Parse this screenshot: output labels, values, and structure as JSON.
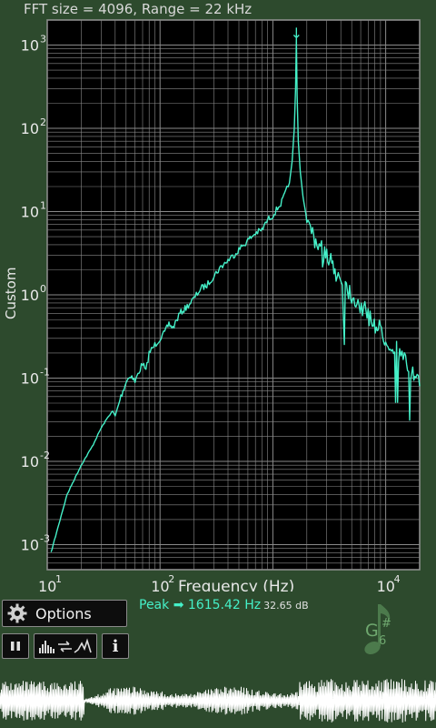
{
  "header": {
    "title": "FFT size = 4096, Range = 22 kHz"
  },
  "chart_data": {
    "type": "line",
    "title": "",
    "xlabel": "Frequency (Hz)",
    "ylabel": "Custom",
    "x_scale": "log",
    "y_scale": "log",
    "xlim": [
      10,
      20000
    ],
    "ylim": [
      0.0005,
      2000
    ],
    "x_ticks": [
      {
        "base": "10",
        "exp": "1",
        "value": 10
      },
      {
        "base": "10",
        "exp": "2",
        "value": 100
      },
      {
        "base": "10",
        "exp": "4",
        "value": 10000
      }
    ],
    "y_ticks": [
      {
        "base": "10",
        "exp": "3",
        "value": 1000
      },
      {
        "base": "10",
        "exp": "2",
        "value": 100
      },
      {
        "base": "10",
        "exp": "1",
        "value": 10
      },
      {
        "base": "10",
        "exp": "0",
        "value": 1
      },
      {
        "base": "10",
        "exp": "-1",
        "value": 0.1
      },
      {
        "base": "10",
        "exp": "-2",
        "value": 0.01
      },
      {
        "base": "10",
        "exp": "-3",
        "value": 0.001
      }
    ],
    "grid": true,
    "line_color": "#45f0c8",
    "peak_marker": {
      "x": 1615.42,
      "symbol": "↓"
    },
    "series": [
      {
        "x": [
          10.8,
          13,
          15,
          20,
          25,
          30,
          35,
          38,
          40,
          45,
          50,
          55,
          60,
          65,
          70,
          75,
          80,
          90,
          100,
          110,
          120,
          130,
          150,
          170,
          200,
          230,
          260,
          300,
          350,
          400,
          450,
          500,
          600,
          700,
          800,
          900,
          1000,
          1100,
          1200,
          1300,
          1400,
          1480,
          1550,
          1590,
          1615,
          1640,
          1680,
          1750,
          1850,
          2000,
          2200,
          2400,
          2700,
          3000,
          3400,
          3800,
          4300,
          5000,
          5800,
          6700,
          7600,
          8600,
          10000,
          11500,
          13000,
          15000,
          17000,
          19000,
          20000
        ],
        "y": [
          0.0008,
          0.002,
          0.004,
          0.009,
          0.015,
          0.025,
          0.035,
          0.04,
          0.035,
          0.06,
          0.09,
          0.11,
          0.09,
          0.12,
          0.15,
          0.12,
          0.2,
          0.25,
          0.3,
          0.35,
          0.45,
          0.4,
          0.6,
          0.7,
          0.9,
          1.2,
          1.3,
          1.7,
          2.2,
          2.6,
          3,
          3.5,
          4.5,
          5.5,
          6,
          8,
          9,
          11,
          13,
          17,
          22,
          40,
          100,
          300,
          1200,
          250,
          70,
          30,
          15,
          8,
          6,
          4.5,
          3.5,
          2.8,
          2.2,
          1.7,
          1.4,
          1,
          0.8,
          0.6,
          0.5,
          0.4,
          0.3,
          0.25,
          0.2,
          0.15,
          0.12,
          0.09,
          0.08
        ]
      }
    ]
  },
  "controls": {
    "options_label": "Options",
    "pause_icon": "pause-icon",
    "mode_icon": "spectrum-mode-icon",
    "info_label": "i"
  },
  "peak": {
    "label": "Peak ➡ 1615.42 Hz",
    "db": "32.65 dB"
  },
  "note": {
    "letter": "G",
    "accidental": "#",
    "octave": "6",
    "color": "#6fa86f"
  },
  "colors": {
    "background": "#2d4a2d",
    "plot_background": "#000000",
    "grid": "#8a8a8a",
    "trace": "#45f0c8",
    "waveform": "#ffffff"
  }
}
